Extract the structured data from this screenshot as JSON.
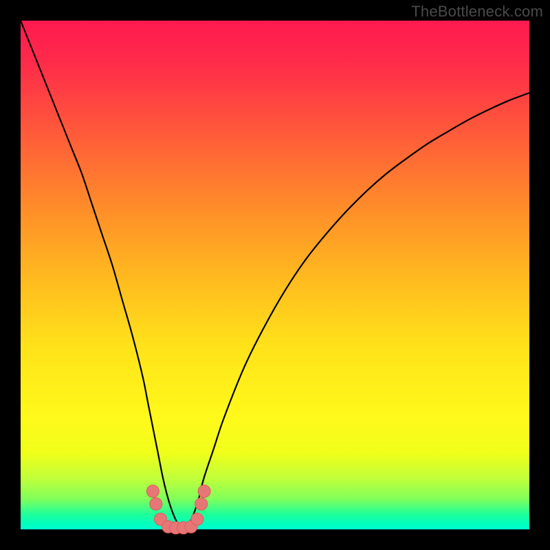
{
  "watermark": {
    "text": "TheBottleneck.com"
  },
  "colors": {
    "frame": "#000000",
    "curve_stroke": "#000000",
    "marker_fill": "#E77777",
    "marker_stroke": "#E05858"
  },
  "chart_data": {
    "type": "line",
    "title": "",
    "xlabel": "",
    "ylabel": "",
    "xlim": [
      0,
      100
    ],
    "ylim": [
      0,
      100
    ],
    "grid": false,
    "legend": false,
    "series": [
      {
        "name": "bottleneck-curve",
        "x": [
          0,
          2,
          4,
          6,
          8,
          10,
          12,
          14,
          16,
          18,
          20,
          22,
          24,
          25,
          26,
          27,
          28,
          29,
          30,
          31,
          32,
          33,
          34,
          35,
          36,
          38,
          40,
          44,
          48,
          52,
          56,
          60,
          64,
          68,
          72,
          76,
          80,
          84,
          88,
          92,
          96,
          100
        ],
        "y": [
          100,
          95,
          90,
          85,
          80,
          75,
          70,
          64,
          58,
          52,
          45,
          38,
          30,
          25,
          20,
          15,
          10,
          6,
          3,
          1,
          0.5,
          1,
          3,
          6,
          10,
          16,
          22,
          32,
          40,
          47,
          53,
          58,
          62.5,
          66.5,
          70,
          73,
          75.8,
          78.2,
          80.5,
          82.5,
          84.3,
          85.8
        ]
      }
    ],
    "markers": {
      "name": "highlight-points",
      "x": [
        26,
        26.6,
        27.5,
        29,
        30.5,
        32,
        33.5,
        34.7,
        35.5,
        36.1
      ],
      "y": [
        7.5,
        5,
        2,
        0.5,
        0.3,
        0.3,
        0.5,
        2,
        5,
        7.5
      ]
    }
  }
}
